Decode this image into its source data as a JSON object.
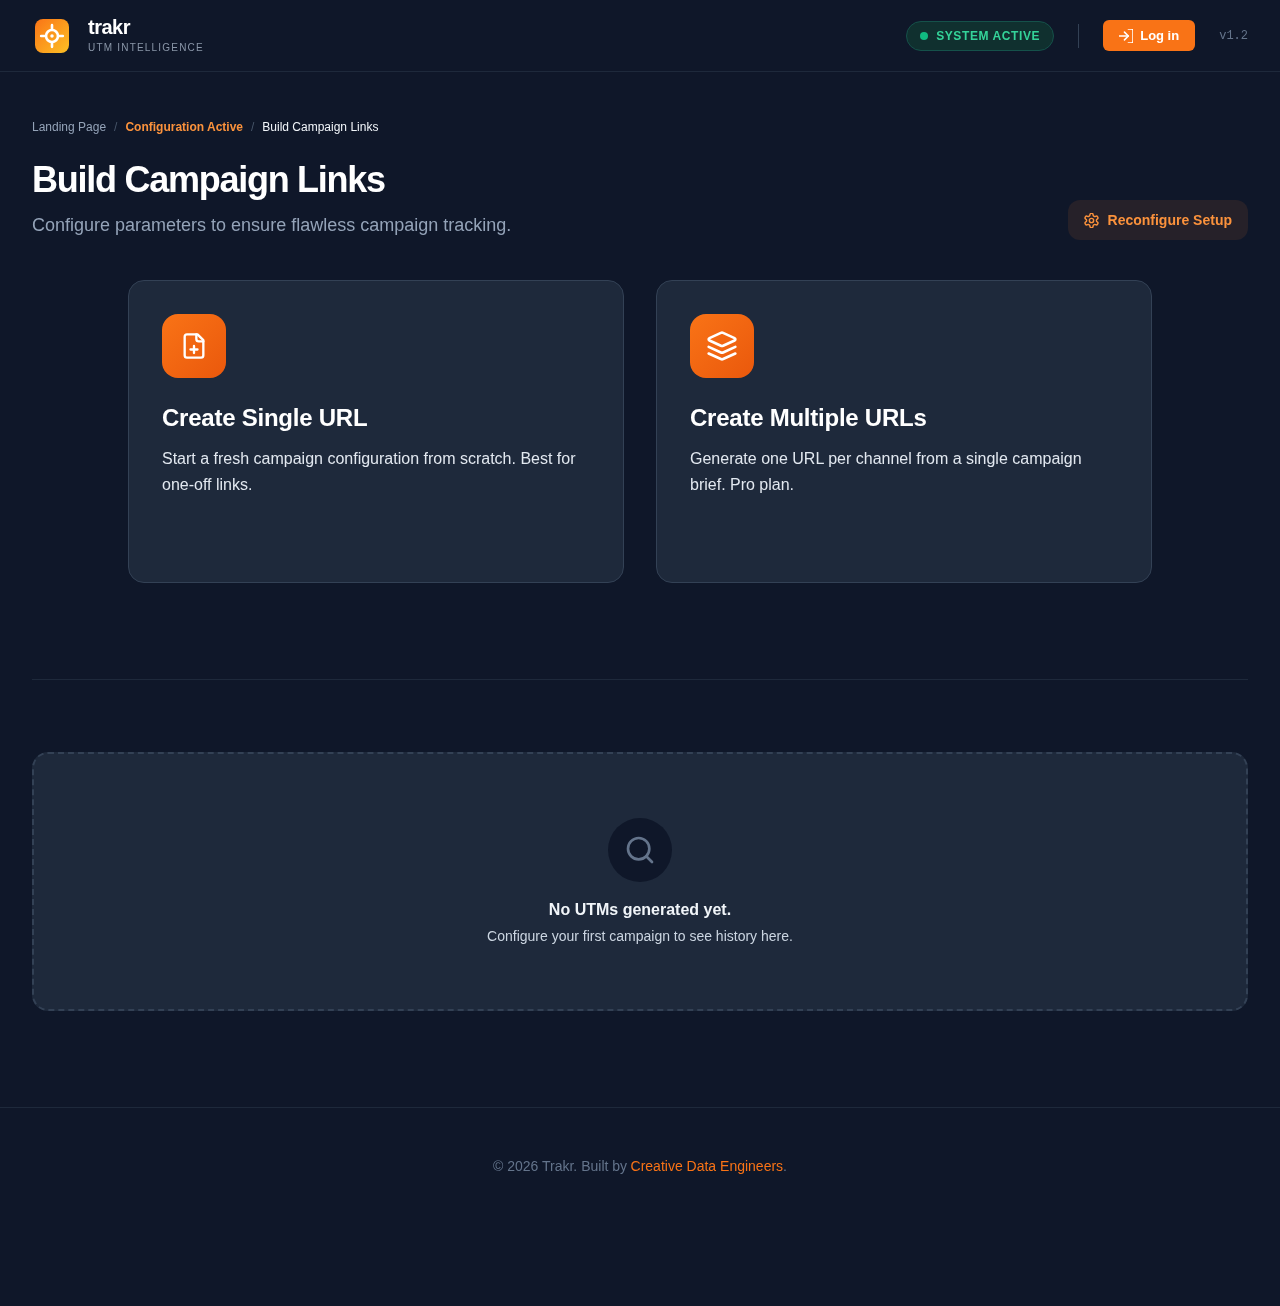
{
  "header": {
    "brand": {
      "name": "trakr",
      "tagline": "UTM INTELLIGENCE"
    },
    "status": {
      "label": "SYSTEM ACTIVE",
      "active": true
    },
    "login_button": {
      "label": "Log in"
    },
    "version": "v1.2"
  },
  "breadcrumbs": [
    {
      "kind": "link",
      "label": "Landing Page"
    },
    {
      "kind": "separator",
      "label": "/"
    },
    {
      "kind": "highlight",
      "label": "Configuration Active"
    },
    {
      "kind": "separator",
      "label": "/"
    },
    {
      "kind": "current",
      "label": "Build Campaign Links"
    }
  ],
  "page": {
    "title": "Build Campaign Links",
    "subtitle": "Configure parameters to ensure flawless campaign tracking.",
    "action_button": {
      "label": "Reconfigure Setup"
    }
  },
  "options": [
    {
      "kind": "single",
      "title": "Create Single URL",
      "description": "Start a fresh campaign configuration from scratch. Best for one-off links."
    },
    {
      "kind": "multiple",
      "title": "Create Multiple URLs",
      "description": "Generate one URL per channel from a single campaign brief. Pro plan."
    }
  ],
  "history": {
    "empty_title": "No UTMs generated yet.",
    "empty_message": "Configure your first campaign to see history here."
  },
  "footer": {
    "text": "© 2026 Trakr. Built by",
    "link": "Creative Data Engineers",
    "text_end": "."
  }
}
